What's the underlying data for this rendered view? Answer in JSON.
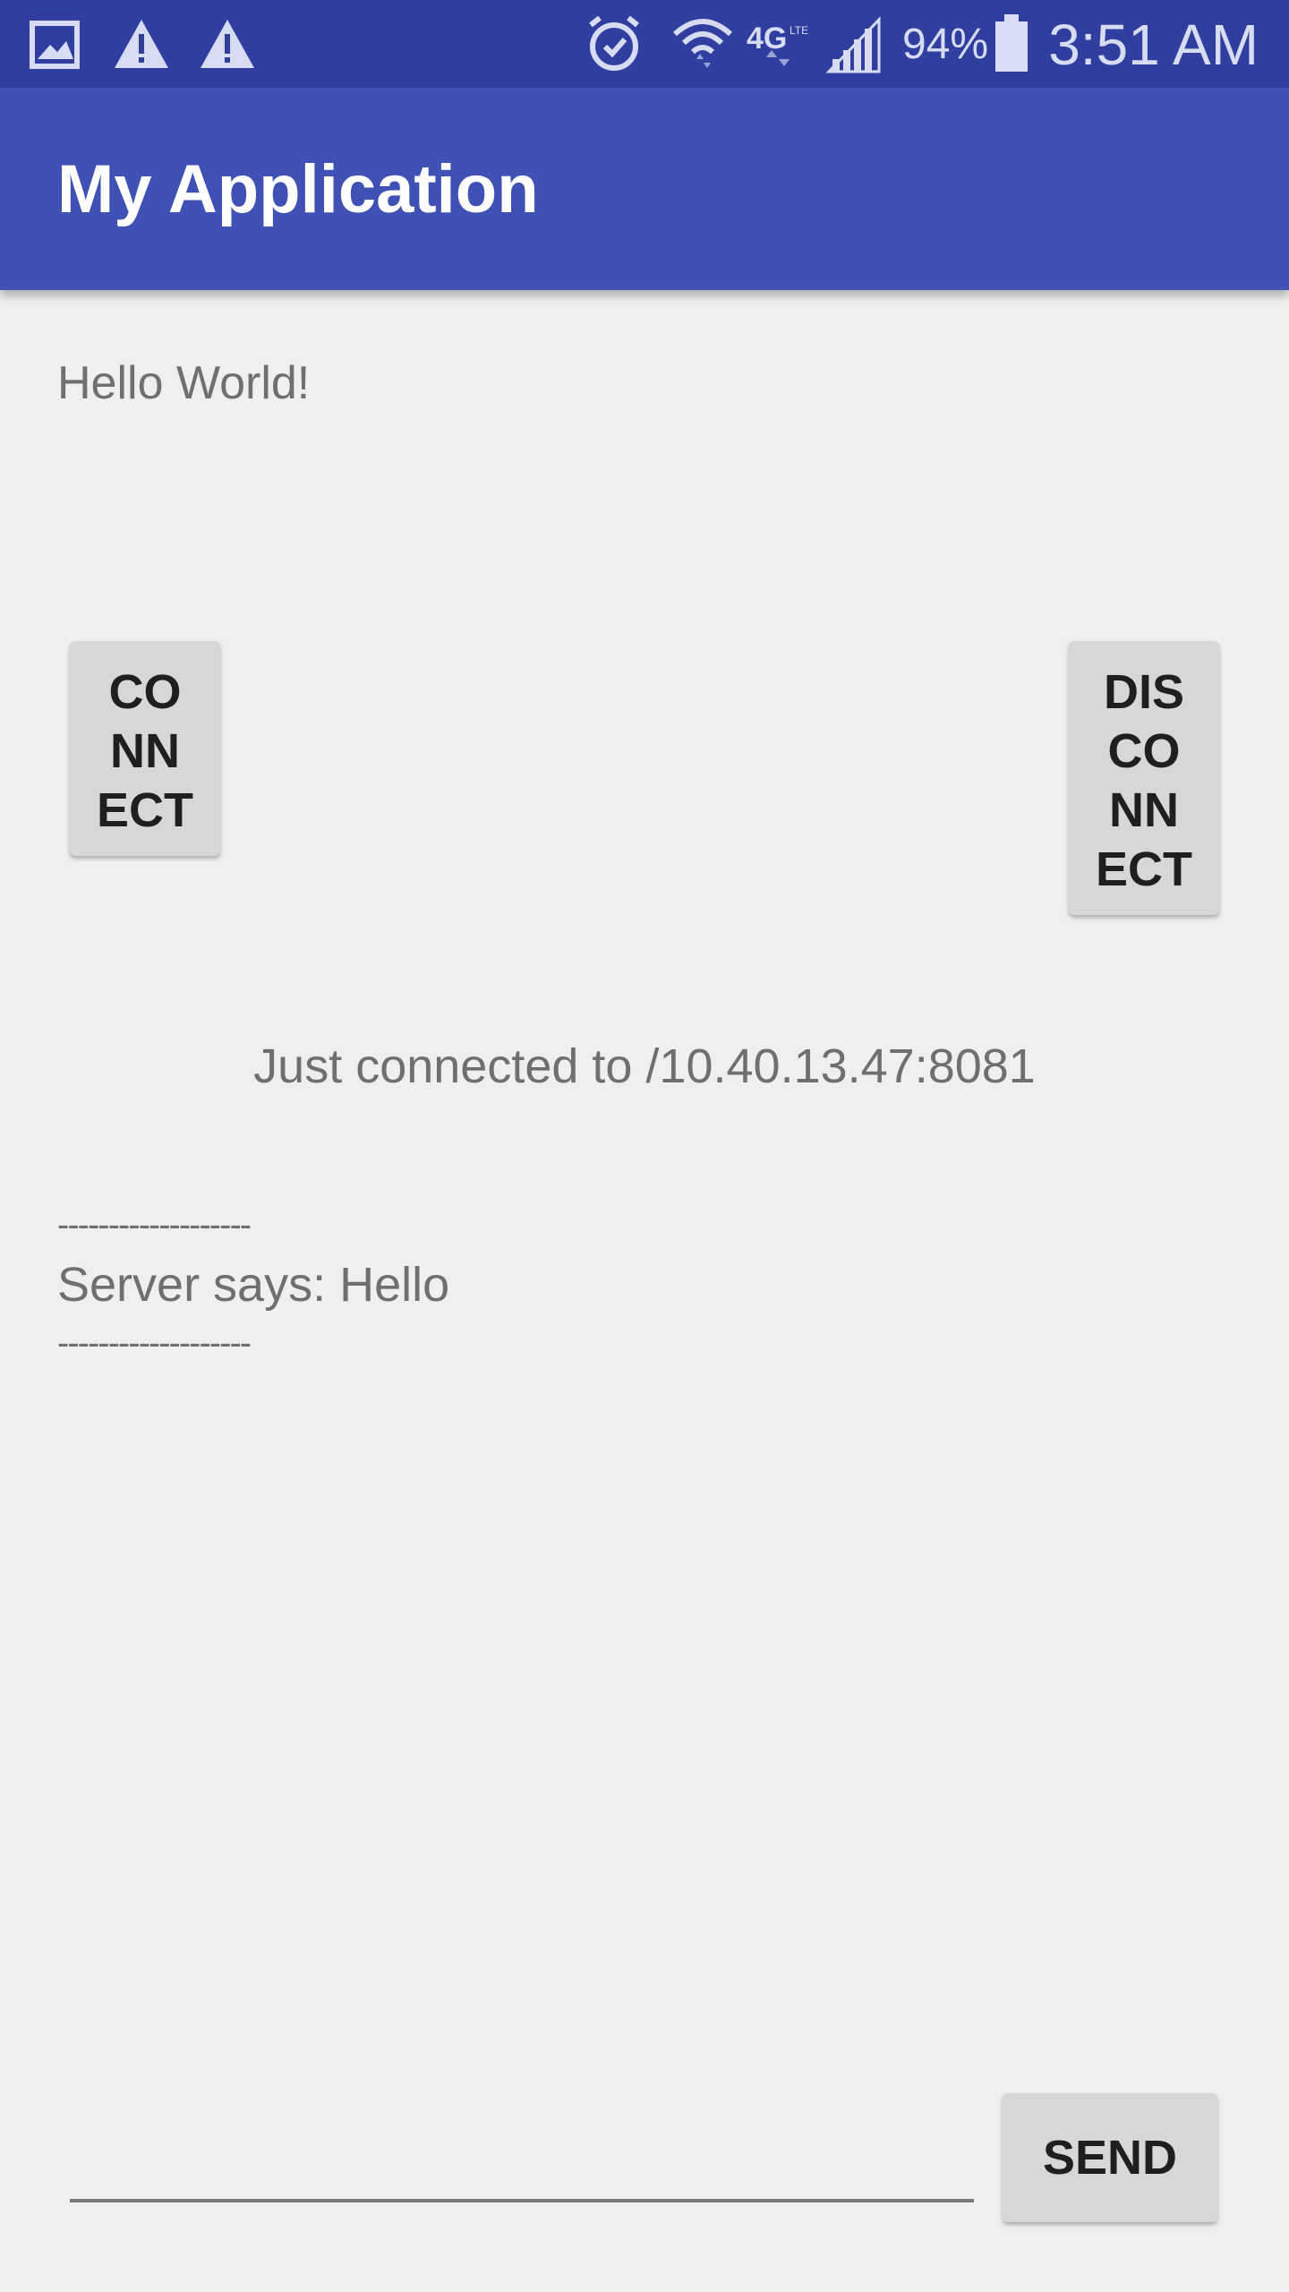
{
  "status_bar": {
    "battery_percent": "94%",
    "time": "3:51 AM",
    "icons": [
      "gallery-icon",
      "warning-icon",
      "warning-icon",
      "alarm-icon",
      "wifi-icon",
      "4g-lte-icon",
      "cell-signal-icon",
      "battery-icon"
    ]
  },
  "app_bar": {
    "title": "My Application"
  },
  "main": {
    "hello_text": "Hello World!",
    "connect_button": {
      "lines": [
        "CO",
        "NN",
        "ECT"
      ]
    },
    "disconnect_button": {
      "lines": [
        "DIS",
        "CO",
        "NN",
        "ECT"
      ]
    },
    "connection_status": "Just connected to /10.40.13.47:8081",
    "log": {
      "separator_top": "-------------------",
      "server_message": "Server says: Hello",
      "separator_bottom": "-------------------"
    }
  },
  "composer": {
    "input_value": "",
    "send_label": "SEND"
  },
  "colors": {
    "status_bar": "#303f9f",
    "app_bar": "#3f51b5",
    "background": "#efefef",
    "button": "#d6d7d7",
    "text_secondary": "#6f6f6f"
  }
}
